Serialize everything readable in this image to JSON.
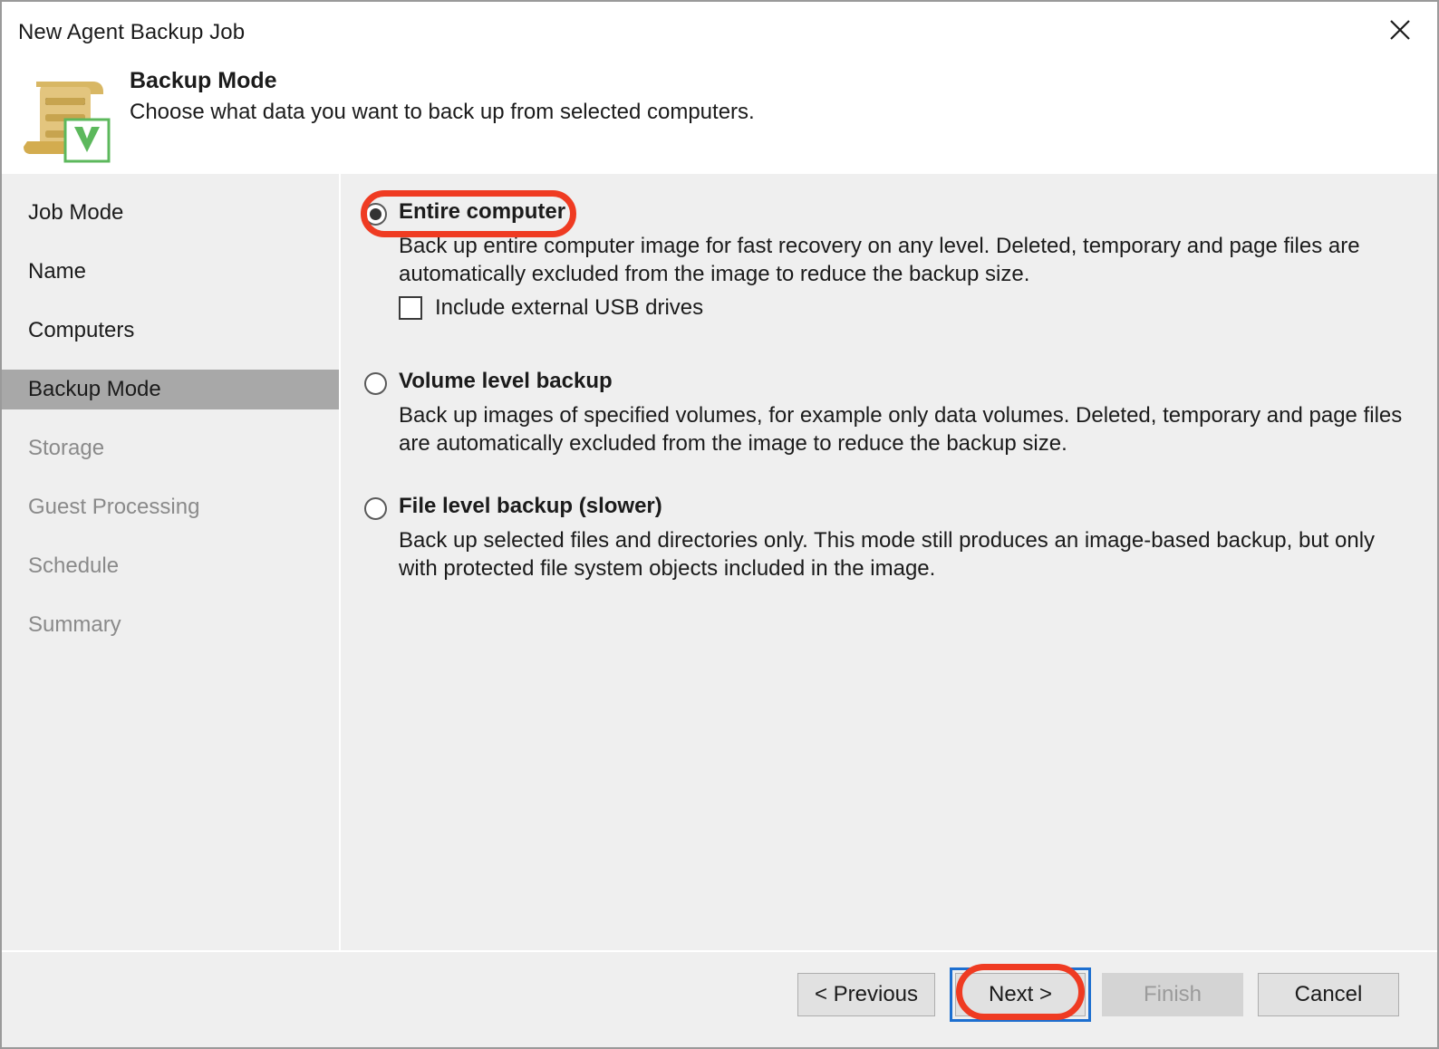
{
  "window": {
    "title": "New Agent Backup Job",
    "close_icon": "close-icon"
  },
  "header": {
    "title": "Backup Mode",
    "subtitle": "Choose what data you want to back up from selected computers.",
    "icon": "document-scroll-veeam-icon"
  },
  "sidebar": {
    "items": [
      {
        "label": "Job Mode",
        "state": "done"
      },
      {
        "label": "Name",
        "state": "done"
      },
      {
        "label": "Computers",
        "state": "done"
      },
      {
        "label": "Backup Mode",
        "state": "active"
      },
      {
        "label": "Storage",
        "state": "pending"
      },
      {
        "label": "Guest Processing",
        "state": "pending"
      },
      {
        "label": "Schedule",
        "state": "pending"
      },
      {
        "label": "Summary",
        "state": "pending"
      }
    ]
  },
  "main": {
    "options": [
      {
        "id": "entire-computer",
        "label": "Entire computer",
        "selected": true,
        "description": "Back up entire computer image for fast recovery on any level. Deleted, temporary and page files are automatically excluded from the image to reduce the backup size.",
        "checkbox": {
          "label": "Include external USB drives",
          "checked": false
        }
      },
      {
        "id": "volume-level-backup",
        "label": "Volume level backup",
        "selected": false,
        "description": "Back up images of specified volumes, for example only data volumes. Deleted, temporary and page files are automatically excluded from the image to reduce the backup size."
      },
      {
        "id": "file-level-backup",
        "label": "File level backup (slower)",
        "selected": false,
        "description": "Back up selected files and directories only. This mode still produces an image-based backup, but only with protected file system objects included in the image."
      }
    ]
  },
  "footer": {
    "previous_label": "< Previous",
    "next_label": "Next >",
    "finish_label": "Finish",
    "cancel_label": "Cancel"
  },
  "annotations": {
    "accent_color": "#ef3b22",
    "focus_color": "#1d6fd0",
    "highlighted": [
      "entire-computer-radio",
      "next-button"
    ]
  }
}
